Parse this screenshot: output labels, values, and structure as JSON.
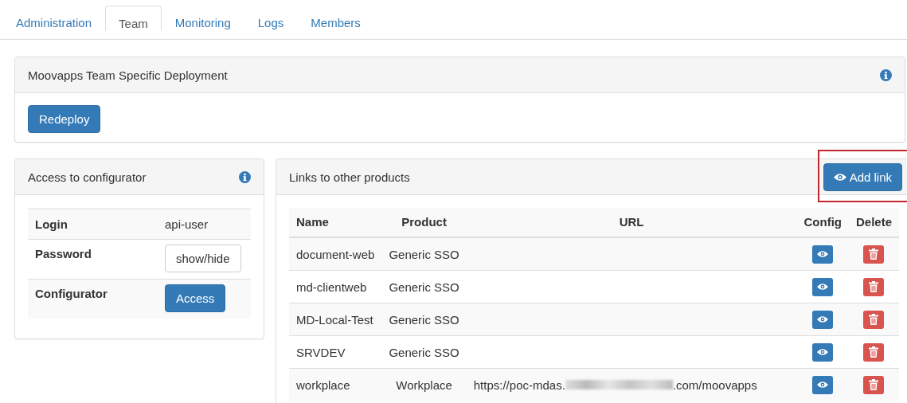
{
  "tabs": [
    {
      "label": "Administration",
      "selected": false
    },
    {
      "label": "Team",
      "selected": true
    },
    {
      "label": "Monitoring",
      "selected": false
    },
    {
      "label": "Logs",
      "selected": false
    },
    {
      "label": "Members",
      "selected": false
    }
  ],
  "deployment_panel": {
    "title": "Moovapps Team Specific Deployment",
    "button": "Redeploy"
  },
  "configurator_panel": {
    "title": "Access to configurator",
    "rows": [
      {
        "label": "Login",
        "kind": "text",
        "value": "api-user"
      },
      {
        "label": "Password",
        "kind": "default-button",
        "value": "show/hide"
      },
      {
        "label": "Configurator",
        "kind": "primary-button",
        "value": "Access"
      }
    ]
  },
  "links_panel": {
    "title": "Links to other products",
    "add_button": "Add link",
    "add_button_highlighted": true,
    "columns": [
      "Name",
      "Product",
      "URL",
      "Config",
      "Delete"
    ],
    "rows": [
      {
        "name": "document-web",
        "product": "Generic SSO"
      },
      {
        "name": "md-clientweb",
        "product": "Generic SSO"
      },
      {
        "name": "MD-Local-Test",
        "product": "Generic SSO"
      },
      {
        "name": "SRVDEV",
        "product": "Generic SSO"
      },
      {
        "name": "workplace",
        "product": "Workplace",
        "url_start": "https://poc-mdas.",
        "url_redacted": true,
        "url_end": ".com/moovapps"
      }
    ]
  }
}
